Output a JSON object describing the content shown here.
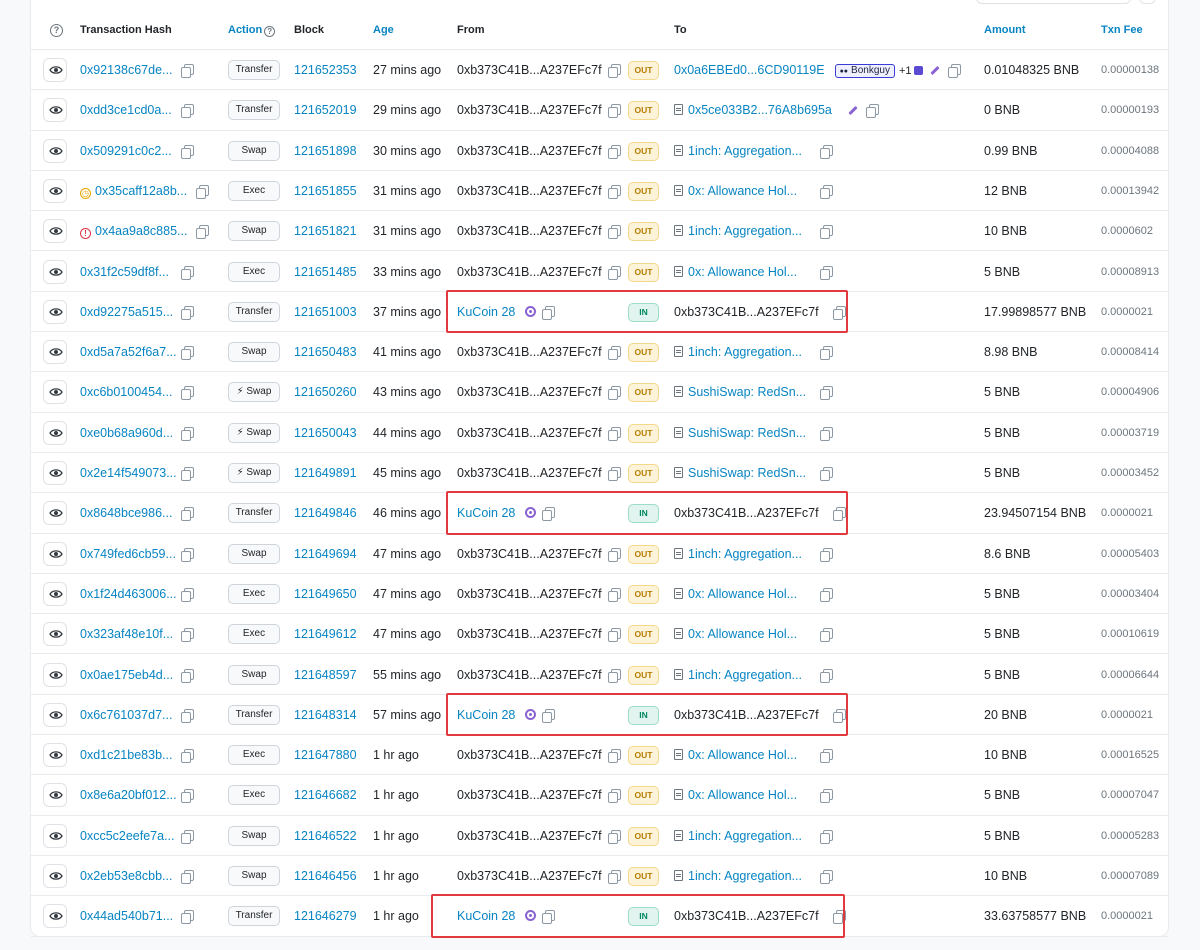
{
  "header": {
    "info_icon": "question-circle-icon",
    "columns": {
      "hash": "Transaction Hash",
      "action": "Action",
      "block": "Block",
      "age": "Age",
      "from": "From",
      "to": "To",
      "amount": "Amount",
      "fee": "Txn Fee"
    }
  },
  "colors": {
    "link": "#0784c3",
    "out_badge": "#b47d00",
    "in_badge": "#00875f",
    "highlight": "#e0393e"
  },
  "rows": [
    {
      "hash": "0x92138c67de...",
      "status": "",
      "action": "Transfer",
      "block": "121652353",
      "age": "27 mins ago",
      "from": "0xb373C41B...A237EFc7f",
      "dir": "OUT",
      "to": "0x0a6EBEd0...6CD90119E",
      "to_type": "addr",
      "tag": "Bonkguy",
      "extra": "+1",
      "amount": "0.01048325 BNB",
      "fee": "0.00000138"
    },
    {
      "hash": "0xdd3ce1cd0a...",
      "status": "",
      "action": "Transfer",
      "block": "121652019",
      "age": "29 mins ago",
      "from": "0xb373C41B...A237EFc7f",
      "dir": "OUT",
      "to": "0x5ce033B2...76A8b695a",
      "to_type": "contract-pen",
      "amount": "0 BNB",
      "fee": "0.00000193"
    },
    {
      "hash": "0x509291c0c2...",
      "status": "",
      "action": "Swap",
      "block": "121651898",
      "age": "30 mins ago",
      "from": "0xb373C41B...A237EFc7f",
      "dir": "OUT",
      "to": "1inch: Aggregation...",
      "to_type": "contract",
      "amount": "0.99 BNB",
      "fee": "0.00004088"
    },
    {
      "hash": "0x35caff12a8b...",
      "status": "pending",
      "action": "Exec",
      "block": "121651855",
      "age": "31 mins ago",
      "from": "0xb373C41B...A237EFc7f",
      "dir": "OUT",
      "to": "0x: Allowance Hol...",
      "to_type": "contract",
      "amount": "12 BNB",
      "fee": "0.00013942"
    },
    {
      "hash": "0x4aa9a8c885...",
      "status": "error",
      "action": "Swap",
      "block": "121651821",
      "age": "31 mins ago",
      "from": "0xb373C41B...A237EFc7f",
      "dir": "OUT",
      "to": "1inch: Aggregation...",
      "to_type": "contract",
      "amount": "10 BNB",
      "fee": "0.0000602"
    },
    {
      "hash": "0x31f2c59df8f...",
      "status": "",
      "action": "Exec",
      "block": "121651485",
      "age": "33 mins ago",
      "from": "0xb373C41B...A237EFc7f",
      "dir": "OUT",
      "to": "0x: Allowance Hol...",
      "to_type": "contract",
      "amount": "5 BNB",
      "fee": "0.00008913"
    },
    {
      "hash": "0xd92275a515...",
      "status": "",
      "action": "Transfer",
      "block": "121651003",
      "age": "37 mins ago",
      "from": "KuCoin 28",
      "from_type": "named",
      "dir": "IN",
      "to": "0xb373C41B...A237EFc7f",
      "to_type": "plain",
      "amount": "17.99898577 BNB",
      "fee": "0.0000021"
    },
    {
      "hash": "0xd5a7a52f6a7...",
      "status": "",
      "action": "Swap",
      "block": "121650483",
      "age": "41 mins ago",
      "from": "0xb373C41B...A237EFc7f",
      "dir": "OUT",
      "to": "1inch: Aggregation...",
      "to_type": "contract",
      "amount": "8.98 BNB",
      "fee": "0.00008414"
    },
    {
      "hash": "0xc6b0100454...",
      "status": "",
      "action": "⚡ Swap",
      "block": "121650260",
      "age": "43 mins ago",
      "from": "0xb373C41B...A237EFc7f",
      "dir": "OUT",
      "to": "SushiSwap: RedSn...",
      "to_type": "contract",
      "amount": "5 BNB",
      "fee": "0.00004906"
    },
    {
      "hash": "0xe0b68a960d...",
      "status": "",
      "action": "⚡ Swap",
      "block": "121650043",
      "age": "44 mins ago",
      "from": "0xb373C41B...A237EFc7f",
      "dir": "OUT",
      "to": "SushiSwap: RedSn...",
      "to_type": "contract",
      "amount": "5 BNB",
      "fee": "0.00003719"
    },
    {
      "hash": "0x2e14f549073...",
      "status": "",
      "action": "⚡ Swap",
      "block": "121649891",
      "age": "45 mins ago",
      "from": "0xb373C41B...A237EFc7f",
      "dir": "OUT",
      "to": "SushiSwap: RedSn...",
      "to_type": "contract",
      "amount": "5 BNB",
      "fee": "0.00003452"
    },
    {
      "hash": "0x8648bce986...",
      "status": "",
      "action": "Transfer",
      "block": "121649846",
      "age": "46 mins ago",
      "from": "KuCoin 28",
      "from_type": "named",
      "dir": "IN",
      "to": "0xb373C41B...A237EFc7f",
      "to_type": "plain",
      "amount": "23.94507154 BNB",
      "fee": "0.0000021"
    },
    {
      "hash": "0x749fed6cb59...",
      "status": "",
      "action": "Swap",
      "block": "121649694",
      "age": "47 mins ago",
      "from": "0xb373C41B...A237EFc7f",
      "dir": "OUT",
      "to": "1inch: Aggregation...",
      "to_type": "contract",
      "amount": "8.6 BNB",
      "fee": "0.00005403"
    },
    {
      "hash": "0x1f24d463006...",
      "status": "",
      "action": "Exec",
      "block": "121649650",
      "age": "47 mins ago",
      "from": "0xb373C41B...A237EFc7f",
      "dir": "OUT",
      "to": "0x: Allowance Hol...",
      "to_type": "contract",
      "amount": "5 BNB",
      "fee": "0.00003404"
    },
    {
      "hash": "0x323af48e10f...",
      "status": "",
      "action": "Exec",
      "block": "121649612",
      "age": "47 mins ago",
      "from": "0xb373C41B...A237EFc7f",
      "dir": "OUT",
      "to": "0x: Allowance Hol...",
      "to_type": "contract",
      "amount": "5 BNB",
      "fee": "0.00010619"
    },
    {
      "hash": "0x0ae175eb4d...",
      "status": "",
      "action": "Swap",
      "block": "121648597",
      "age": "55 mins ago",
      "from": "0xb373C41B...A237EFc7f",
      "dir": "OUT",
      "to": "1inch: Aggregation...",
      "to_type": "contract",
      "amount": "5 BNB",
      "fee": "0.00006644"
    },
    {
      "hash": "0x6c761037d7...",
      "status": "",
      "action": "Transfer",
      "block": "121648314",
      "age": "57 mins ago",
      "from": "KuCoin 28",
      "from_type": "named",
      "dir": "IN",
      "to": "0xb373C41B...A237EFc7f",
      "to_type": "plain",
      "amount": "20 BNB",
      "fee": "0.0000021"
    },
    {
      "hash": "0xd1c21be83b...",
      "status": "",
      "action": "Exec",
      "block": "121647880",
      "age": "1 hr ago",
      "from": "0xb373C41B...A237EFc7f",
      "dir": "OUT",
      "to": "0x: Allowance Hol...",
      "to_type": "contract",
      "amount": "10 BNB",
      "fee": "0.00016525"
    },
    {
      "hash": "0x8e6a20bf012...",
      "status": "",
      "action": "Exec",
      "block": "121646682",
      "age": "1 hr ago",
      "from": "0xb373C41B...A237EFc7f",
      "dir": "OUT",
      "to": "0x: Allowance Hol...",
      "to_type": "contract",
      "amount": "5 BNB",
      "fee": "0.00007047"
    },
    {
      "hash": "0xcc5c2eefe7a...",
      "status": "",
      "action": "Swap",
      "block": "121646522",
      "age": "1 hr ago",
      "from": "0xb373C41B...A237EFc7f",
      "dir": "OUT",
      "to": "1inch: Aggregation...",
      "to_type": "contract",
      "amount": "5 BNB",
      "fee": "0.00005283"
    },
    {
      "hash": "0x2eb53e8cbb...",
      "status": "",
      "action": "Swap",
      "block": "121646456",
      "age": "1 hr ago",
      "from": "0xb373C41B...A237EFc7f",
      "dir": "OUT",
      "to": "1inch: Aggregation...",
      "to_type": "contract",
      "amount": "10 BNB",
      "fee": "0.00007089"
    },
    {
      "hash": "0x44ad540b71...",
      "status": "",
      "action": "Transfer",
      "block": "121646279",
      "age": "1 hr ago",
      "from": "KuCoin 28",
      "from_type": "named",
      "dir": "IN",
      "to": "0xb373C41B...A237EFc7f",
      "to_type": "plain",
      "amount": "33.63758577 BNB",
      "fee": "0.0000021"
    }
  ]
}
